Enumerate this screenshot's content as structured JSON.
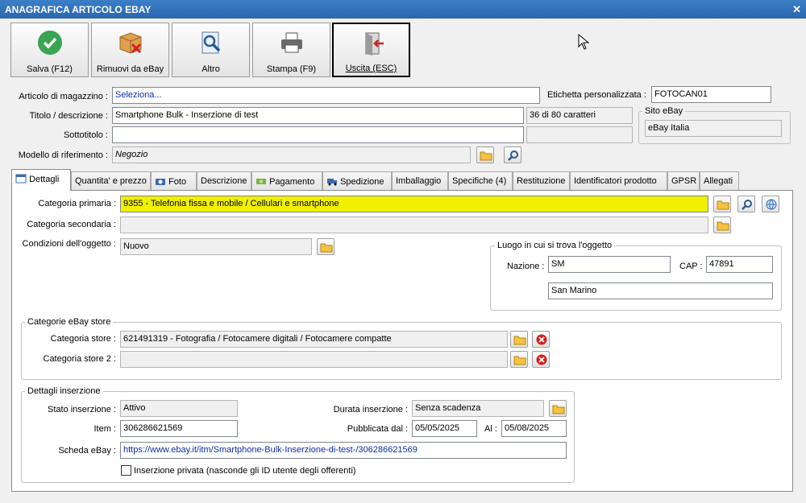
{
  "window": {
    "title": "ANAGRAFICA ARTICOLO EBAY",
    "close": "✕"
  },
  "toolbar": {
    "save": "Salva (F12)",
    "remove": "Rimuovi da eBay",
    "other": "Altro",
    "print": "Stampa (F9)",
    "exit": "Uscita (ESC)"
  },
  "form": {
    "articolo_label": "Articolo di magazzino :",
    "articolo_value": "Seleziona...",
    "etichetta_label": "Etichetta personalizzata :",
    "etichetta_value": "FOTOCAN01",
    "titolo_label": "Titolo / descrizione :",
    "titolo_value": "Smartphone Bulk - Inserzione di test",
    "char_count": "36 di 80 caratteri",
    "sottotitolo_label": "Sottotitolo :",
    "sottotitolo_value": "",
    "modello_label": "Modello di riferimento :",
    "modello_value": "Negozio",
    "sito_title": "Sito eBay",
    "sito_value": "eBay Italia"
  },
  "tabs": [
    "Dettagli",
    "Quantita' e prezzo",
    "Foto",
    "Descrizione",
    "Pagamento",
    "Spedizione",
    "Imballaggio",
    "Specifiche (4)",
    "Restituzione",
    "Identificatori prodotto",
    "GPSR",
    "Allegati"
  ],
  "dettagli": {
    "cat_primaria_label": "Categoria primaria :",
    "cat_primaria_value": "9355 - Telefonia fissa e mobile / Cellulari e smartphone",
    "cat_secondaria_label": "Categoria secondaria :",
    "cat_secondaria_value": "",
    "condizioni_label": "Condizioni dell'oggetto :",
    "condizioni_value": "Nuovo",
    "luogo_title": "Luogo in cui si trova l'oggetto",
    "nazione_label": "Nazione :",
    "nazione_value": "SM",
    "cap_label": "CAP :",
    "cap_value": "47891",
    "citta_value": "San Marino",
    "store_title": "Categorie eBay store",
    "store1_label": "Categoria store :",
    "store1_value": "621491319 - Fotografia / Fotocamere digitali / Fotocamere compatte",
    "store2_label": "Categoria store 2 :",
    "store2_value": "",
    "ins_title": "Dettagli inserzione",
    "stato_label": "Stato inserzione :",
    "stato_value": "Attivo",
    "durata_label": "Durata inserzione :",
    "durata_value": "Senza scadenza",
    "item_label": "Item :",
    "item_value": "306286621569",
    "pubblicata_label": "Pubblicata dal :",
    "pubblicata_value": "05/05/2025",
    "al_label": "Al :",
    "al_value": "05/08/2025",
    "scheda_label": "Scheda eBay :",
    "scheda_value": "https://www.ebay.it/itm/Smartphone-Bulk-Inserzione-di-test-/306286621569",
    "privata_label": "Inserzione privata (nasconde gli ID utente degli offerenti)"
  },
  "colors": {
    "highlight": "#f0f000",
    "titlebar": "#2a66b0",
    "link": "#0b2fa3"
  }
}
